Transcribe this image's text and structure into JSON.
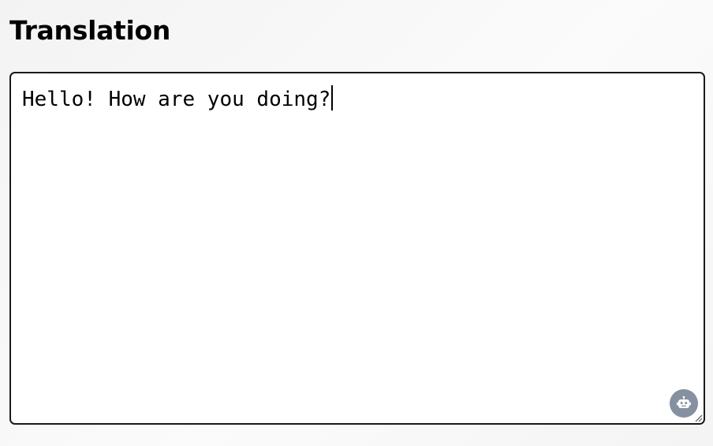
{
  "page": {
    "title": "Translation"
  },
  "editor": {
    "value": "Hello! How are you doing?"
  },
  "icons": {
    "assistant": "robot-icon",
    "resize": "resize-grip-icon"
  },
  "colors": {
    "assistant_button_bg": "#8590a0",
    "border": "#1a1a1a"
  }
}
